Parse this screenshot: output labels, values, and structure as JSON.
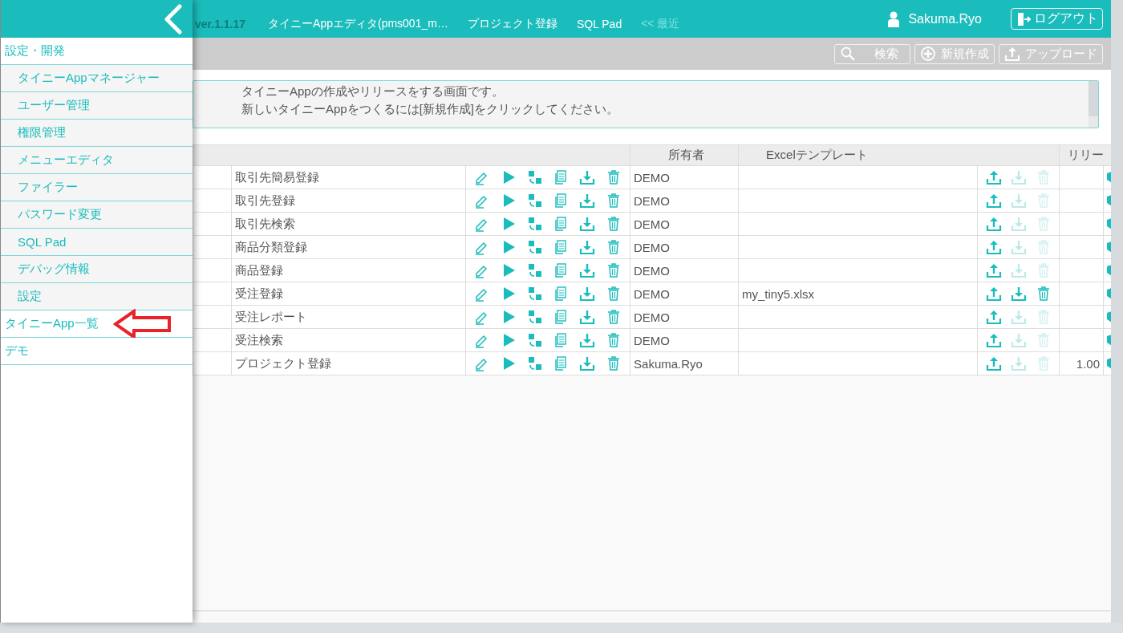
{
  "header": {
    "version": "ver.1.1.17",
    "nav": [
      {
        "label": "タイニーAppエディタ(pms001_m…",
        "kind": "link"
      },
      {
        "label": "プロジェクト登録",
        "kind": "link"
      },
      {
        "label": "SQL Pad",
        "kind": "link"
      },
      {
        "label": "<< 最近",
        "kind": "recent"
      }
    ],
    "user": "Sakuma.Ryo",
    "logout": "ログアウト"
  },
  "toolbar": [
    {
      "label": "検索",
      "kind": "search"
    },
    {
      "label": "新規作成",
      "kind": "plus"
    },
    {
      "label": "アップロード",
      "kind": "upload"
    }
  ],
  "description": [
    "タイニーAppの作成やリリースをする画面です。",
    "新しいタイニーAppをつくるには[新規作成]をクリックしてください。"
  ],
  "table": {
    "columns": [
      "所有者",
      "Excelテンプレート",
      "リリー"
    ],
    "rows": [
      {
        "name": "取引先簡易登録",
        "owner": "DEMO",
        "template_actions_enabled": false
      },
      {
        "name": "取引先登録",
        "owner": "DEMO",
        "template_actions_enabled": false
      },
      {
        "name": "取引先検索",
        "owner": "DEMO",
        "template_actions_enabled": false
      },
      {
        "name": "商品分類登録",
        "owner": "DEMO",
        "template_actions_enabled": false
      },
      {
        "name": "商品登録",
        "owner": "DEMO",
        "template_actions_enabled": false
      },
      {
        "name": "受注登録",
        "owner": "DEMO",
        "template": "my_tiny5.xlsx",
        "template_actions_enabled": true
      },
      {
        "name": "受注レポート",
        "owner": "DEMO",
        "template_actions_enabled": false
      },
      {
        "name": "受注検索",
        "owner": "DEMO",
        "template_actions_enabled": false
      },
      {
        "name": "プロジェクト登録",
        "owner": "Sakuma.Ryo",
        "template_actions_enabled": false,
        "release": "1.00"
      }
    ]
  },
  "sidebar": {
    "items": [
      {
        "label": "設定・開発",
        "children": [
          {
            "label": "タイニーAppマネージャー"
          },
          {
            "label": "ユーザー管理"
          },
          {
            "label": "権限管理"
          },
          {
            "label": "メニューエディタ"
          },
          {
            "label": "ファイラー"
          },
          {
            "label": "パスワード変更"
          },
          {
            "label": "SQL Pad"
          },
          {
            "label": "デバッグ情報"
          },
          {
            "label": "設定"
          }
        ]
      },
      {
        "label": "タイニーApp一覧"
      },
      {
        "label": "デモ"
      }
    ]
  }
}
